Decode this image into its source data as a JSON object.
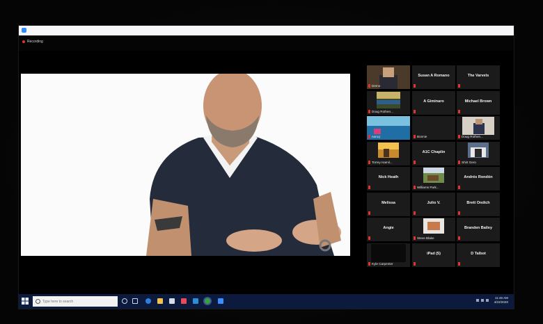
{
  "recording": {
    "label": "Recording"
  },
  "search": {
    "placeholder": "Type here to search"
  },
  "clock": {
    "time": "11:46 AM",
    "date": "4/22/2020"
  },
  "gallery": [
    {
      "name": "",
      "label": "Demo",
      "video": "selfie",
      "active": true
    },
    {
      "name": "Susan A Romano",
      "label": ""
    },
    {
      "name": "The Varvels",
      "label": ""
    },
    {
      "name": "",
      "label": "Doug Rothen...",
      "video": "photo-lake"
    },
    {
      "name": "A Giminaro",
      "label": ""
    },
    {
      "name": "Michael Brown",
      "label": ""
    },
    {
      "name": "",
      "label": "nancy",
      "video": "photo-ocean"
    },
    {
      "name": "",
      "label": "Bonnie"
    },
    {
      "name": "",
      "label": "Doug Rothen...",
      "video": "photo-man"
    },
    {
      "name": "",
      "label": "Torrey Hamil...",
      "video": "photo-sunset"
    },
    {
      "name": "A1C Chaplin",
      "label": ""
    },
    {
      "name": "",
      "label": "Shirt Gero",
      "video": "photo-people"
    },
    {
      "name": "Nick Heath",
      "label": ""
    },
    {
      "name": "",
      "label": "Williams Park...",
      "video": "photo-field"
    },
    {
      "name": "Andrés Rondón",
      "label": ""
    },
    {
      "name": "Melissa",
      "label": ""
    },
    {
      "name": "Julio V.",
      "label": ""
    },
    {
      "name": "Brett Ondich",
      "label": ""
    },
    {
      "name": "Angie",
      "label": ""
    },
    {
      "name": "",
      "label": "Steve Blake",
      "video": "photo-cat"
    },
    {
      "name": "Branden Bailey",
      "label": ""
    },
    {
      "name": "",
      "label": "Kyle Carpenter",
      "video": "photo-dark"
    },
    {
      "name": "iPad (5)",
      "label": ""
    },
    {
      "name": "D Talbot",
      "label": ""
    }
  ],
  "colors": {
    "active_border": "#b6d83a",
    "taskbar": "#0b1a3d",
    "mute": "#e0352b"
  }
}
